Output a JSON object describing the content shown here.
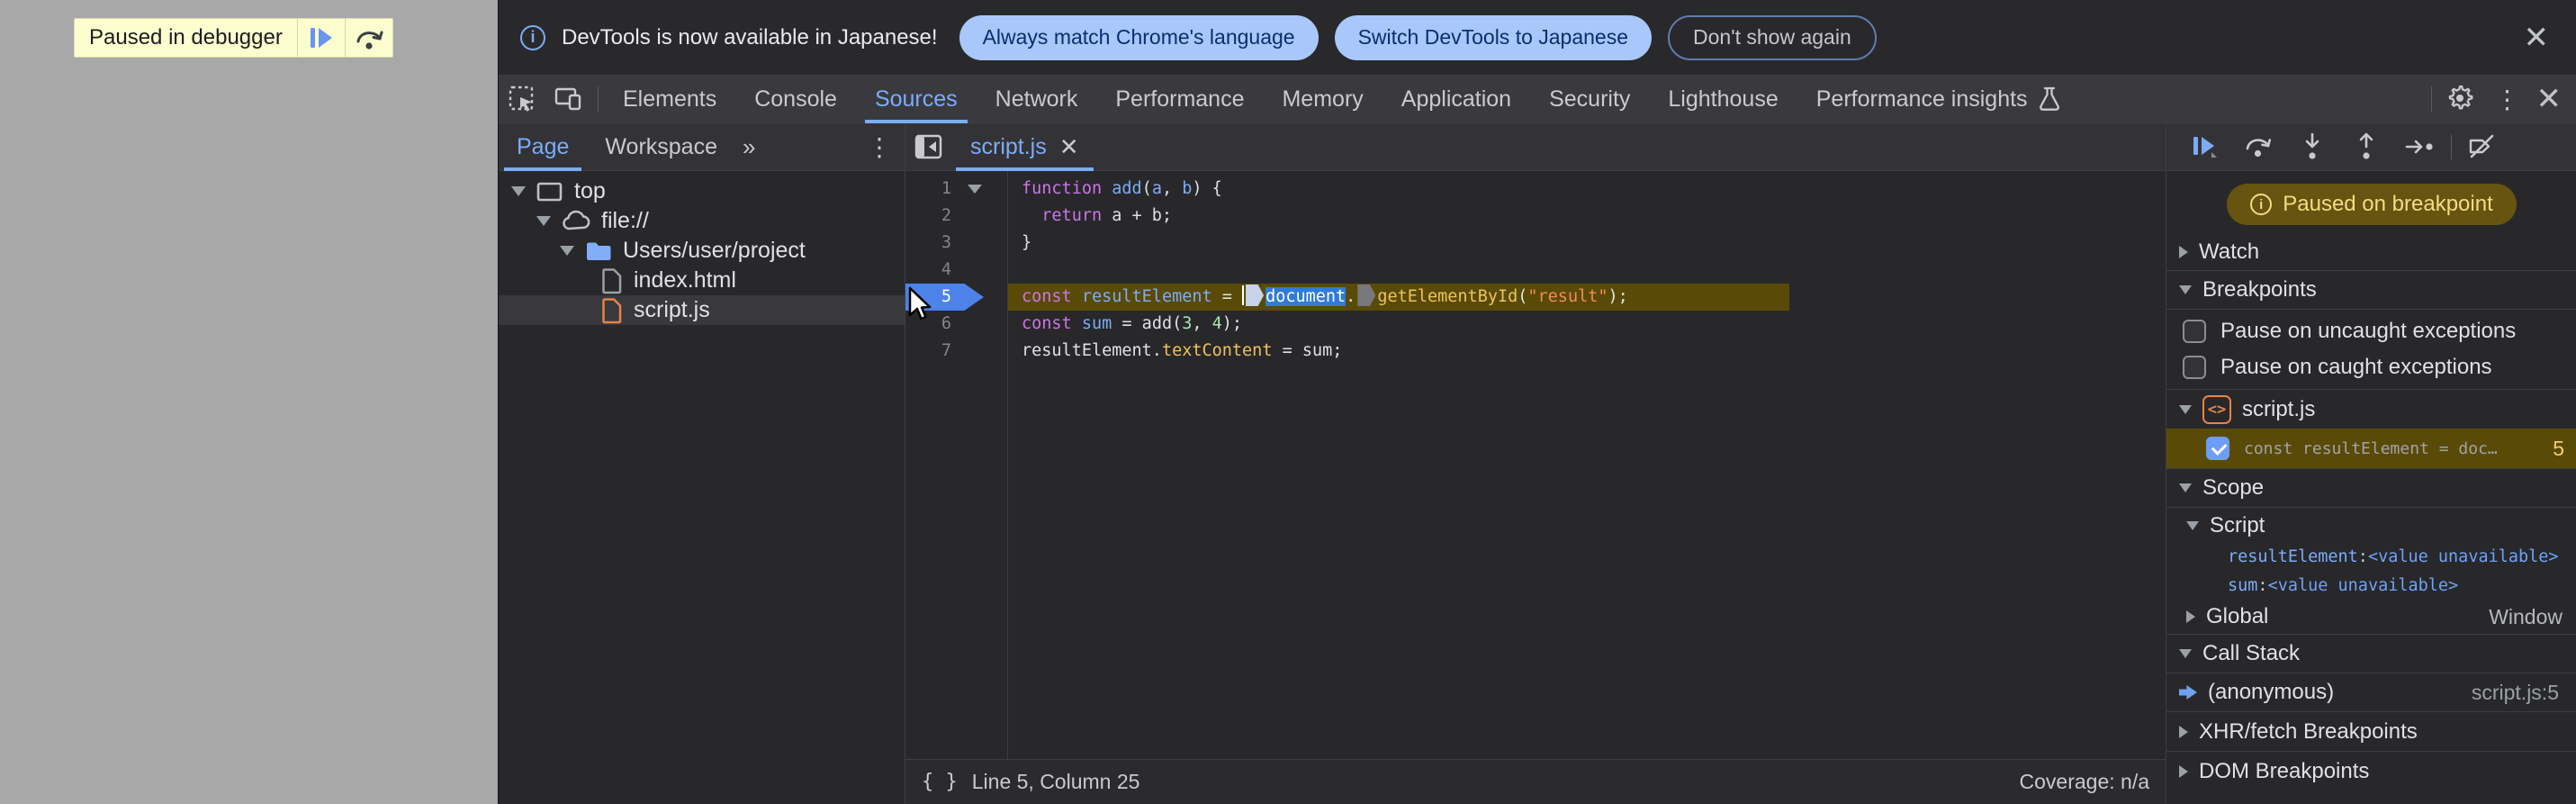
{
  "page_overlay": {
    "label": "Paused in debugger"
  },
  "infobar": {
    "message": "DevTools is now available in Japanese!",
    "btn_match": "Always match Chrome's language",
    "btn_switch": "Switch DevTools to Japanese",
    "btn_dismiss": "Don't show again",
    "close": "✕"
  },
  "main_tabs": {
    "items": [
      {
        "label": "Elements",
        "selected": false
      },
      {
        "label": "Console",
        "selected": false
      },
      {
        "label": "Sources",
        "selected": true
      },
      {
        "label": "Network",
        "selected": false
      },
      {
        "label": "Performance",
        "selected": false
      },
      {
        "label": "Memory",
        "selected": false
      },
      {
        "label": "Application",
        "selected": false
      },
      {
        "label": "Security",
        "selected": false
      },
      {
        "label": "Lighthouse",
        "selected": false
      },
      {
        "label": "Performance insights",
        "selected": false,
        "icon": "flask"
      }
    ],
    "close": "✕",
    "more": "⋮",
    "gear": "⚙"
  },
  "navigator": {
    "tab_page": "Page",
    "tab_workspace": "Workspace",
    "more_tabs": "»",
    "menu": "⋮",
    "tree": [
      {
        "indent": 14,
        "expander": "open",
        "icon": "frame",
        "label": "top",
        "selected": false
      },
      {
        "indent": 42,
        "expander": "open",
        "icon": "cloud",
        "label": "file://",
        "selected": false
      },
      {
        "indent": 68,
        "expander": "open",
        "icon": "folder",
        "label": "Users/user/project",
        "selected": false
      },
      {
        "indent": 112,
        "expander": null,
        "icon": "file-gray",
        "label": "index.html",
        "selected": false
      },
      {
        "indent": 112,
        "expander": null,
        "icon": "file-orange",
        "label": "script.js",
        "selected": true
      }
    ]
  },
  "editor": {
    "tab": "script.js",
    "tab_close": "✕",
    "exec_line": 5,
    "lines": [
      {
        "n": 1,
        "fold": true,
        "tokens": [
          {
            "c": "kw",
            "t": "function"
          },
          {
            "c": "pl",
            "t": " "
          },
          {
            "c": "def",
            "t": "add"
          },
          {
            "c": "pl",
            "t": "("
          },
          {
            "c": "def",
            "t": "a"
          },
          {
            "c": "pl",
            "t": ", "
          },
          {
            "c": "def",
            "t": "b"
          },
          {
            "c": "pl",
            "t": ") {"
          }
        ]
      },
      {
        "n": 2,
        "fold": false,
        "tokens": [
          {
            "c": "pl",
            "t": "  "
          },
          {
            "c": "kw",
            "t": "return"
          },
          {
            "c": "pl",
            "t": " a + b;"
          }
        ]
      },
      {
        "n": 3,
        "fold": false,
        "tokens": [
          {
            "c": "pl",
            "t": "}"
          }
        ]
      },
      {
        "n": 4,
        "fold": false,
        "tokens": []
      },
      {
        "n": 5,
        "fold": false,
        "tokens": [
          {
            "c": "kw",
            "t": "const"
          },
          {
            "c": "pl",
            "t": " "
          },
          {
            "c": "def",
            "t": "resultElement"
          },
          {
            "c": "pl",
            "t": " = "
          },
          {
            "c": "caret"
          },
          {
            "c": "chip-light"
          },
          {
            "c": "sel",
            "t": "document"
          },
          {
            "c": "pl",
            "t": "."
          },
          {
            "c": "chip-dark"
          },
          {
            "c": "prop",
            "t": "getElementById"
          },
          {
            "c": "pl",
            "t": "("
          },
          {
            "c": "str",
            "t": "\"result\""
          },
          {
            "c": "pl",
            "t": ");"
          }
        ]
      },
      {
        "n": 6,
        "fold": false,
        "tokens": [
          {
            "c": "kw",
            "t": "const"
          },
          {
            "c": "pl",
            "t": " "
          },
          {
            "c": "def",
            "t": "sum"
          },
          {
            "c": "pl",
            "t": " = add("
          },
          {
            "c": "num",
            "t": "3"
          },
          {
            "c": "pl",
            "t": ", "
          },
          {
            "c": "num",
            "t": "4"
          },
          {
            "c": "pl",
            "t": ");"
          }
        ]
      },
      {
        "n": 7,
        "fold": false,
        "tokens": [
          {
            "c": "pl",
            "t": "resultElement."
          },
          {
            "c": "prop",
            "t": "textContent"
          },
          {
            "c": "pl",
            "t": " = sum;"
          }
        ]
      }
    ],
    "status": {
      "braces": "{ }",
      "position": "Line 5, Column 25",
      "coverage": "Coverage: n/a"
    }
  },
  "debugger": {
    "paused_badge": "Paused on breakpoint",
    "sections": {
      "watch": "Watch",
      "breakpoints": "Breakpoints",
      "scope": "Scope",
      "call_stack": "Call Stack",
      "xhr": "XHR/fetch Breakpoints",
      "dom": "DOM Breakpoints"
    },
    "breakpoints": {
      "uncaught": "Pause on uncaught exceptions",
      "caught": "Pause on caught exceptions",
      "file": "script.js",
      "entry": {
        "text": "const resultElement = doc…",
        "line": "5"
      }
    },
    "scope": {
      "script_label": "Script",
      "vars": [
        {
          "name": "resultElement",
          "colon": ": ",
          "value": "<value unavailable>"
        },
        {
          "name": "sum",
          "colon": ": ",
          "value": "<value unavailable>"
        }
      ],
      "global_label": "Global",
      "global_value": "Window"
    },
    "call_stack": {
      "frame": "(anonymous)",
      "location": "script.js:5"
    }
  }
}
